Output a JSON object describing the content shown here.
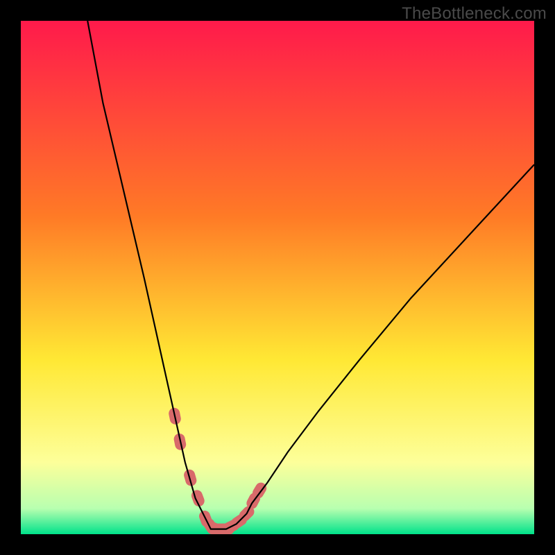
{
  "watermark": "TheBottleneck.com",
  "colors": {
    "frame": "#000000",
    "grad_top": "#ff1a4b",
    "grad_mid1": "#ff7a26",
    "grad_mid2": "#ffe834",
    "grad_low": "#fdff9a",
    "grad_bottom1": "#b8ffb0",
    "grad_bottom2": "#00e28a",
    "curve": "#000000",
    "marker": "#d86a6a"
  },
  "chart_data": {
    "type": "line",
    "title": "",
    "xlabel": "",
    "ylabel": "",
    "xlim": [
      0,
      100
    ],
    "ylim": [
      0,
      100
    ],
    "series": [
      {
        "name": "bottleneck-curve",
        "x": [
          13,
          16,
          20,
          24,
          28,
          30,
          32,
          34,
          36,
          37,
          38,
          40,
          42,
          44,
          45,
          48,
          52,
          58,
          66,
          76,
          88,
          100
        ],
        "y": [
          100,
          84,
          67,
          50,
          32,
          23,
          14,
          7,
          3,
          1,
          1,
          1,
          2,
          4,
          6,
          10,
          16,
          24,
          34,
          46,
          59,
          72
        ]
      }
    ],
    "markers": {
      "name": "highlight-band",
      "x": [
        30.0,
        31.0,
        33.0,
        34.5,
        36.0,
        37.0,
        38.0,
        39.0,
        40.0,
        41.0,
        42.5,
        44.0,
        45.3,
        46.5
      ],
      "y": [
        23.0,
        18.0,
        11.0,
        7.0,
        3.0,
        1.5,
        1.0,
        1.0,
        1.0,
        1.5,
        2.5,
        4.0,
        6.5,
        8.5
      ]
    }
  }
}
